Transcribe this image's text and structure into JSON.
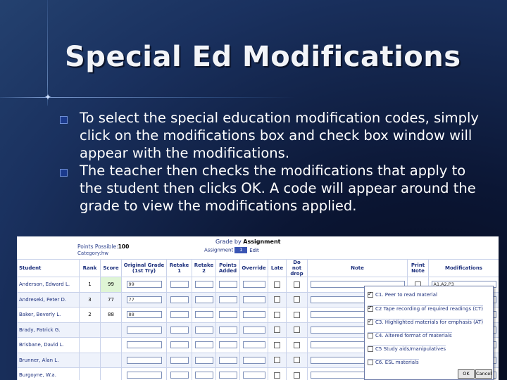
{
  "slide": {
    "title": "Special Ed Modifications",
    "bullets": [
      "To select the special education modification codes, simply click on the modifications box and check box window will appear with the modifications.",
      "The teacher then checks the modifications that apply to the student then clicks OK. A code will appear around the grade to view the modifications applied."
    ]
  },
  "screenshot": {
    "points_possible_label": "Points Possible:",
    "points_possible_value": "100",
    "category_label": "Category:hw",
    "grade_by_label": "Grade by",
    "grade_by_value": "Assignment",
    "assignment_label": "Assignment",
    "assignment_value": "1",
    "edit_label": "Edit",
    "columns": [
      "Student",
      "Rank",
      "Score",
      "Original Grade (1st Try)",
      "Retake 1",
      "Retake 2",
      "Points Added",
      "Override",
      "Late",
      "Do not drop",
      "Note",
      "Print Note",
      "Modifications"
    ],
    "rows": [
      {
        "student": "Anderson, Edward L.",
        "rank": "1",
        "score": "99",
        "original": "99",
        "modifications": "A1,A2,P3"
      },
      {
        "student": "Andreseki, Peter D.",
        "rank": "3",
        "score": "77",
        "original": "77",
        "modifications": ""
      },
      {
        "student": "Baker, Beverly L.",
        "rank": "2",
        "score": "88",
        "original": "88",
        "modifications": ""
      },
      {
        "student": "Brady, Patrick G.",
        "rank": "",
        "score": "",
        "original": "",
        "modifications": ""
      },
      {
        "student": "Brisbane, David L.",
        "rank": "",
        "score": "",
        "original": "",
        "modifications": ""
      },
      {
        "student": "Brunner, Alan L.",
        "rank": "",
        "score": "",
        "original": "",
        "modifications": ""
      },
      {
        "student": "Burgoyne, W.a.",
        "rank": "",
        "score": "",
        "original": "",
        "modifications": ""
      }
    ],
    "popup": {
      "options": [
        {
          "label": "C1. Peer to read material",
          "checked": true
        },
        {
          "label": "C2 Tape recording of required readings (CT)",
          "checked": true
        },
        {
          "label": "C3. Highlighted materials for emphasis (AT)",
          "checked": true
        },
        {
          "label": "C4. Altered format of materials",
          "checked": false
        },
        {
          "label": "C5 Study aids/manipulatives",
          "checked": false
        },
        {
          "label": "C6. ESL materials",
          "checked": false
        }
      ],
      "ok_label": "OK",
      "cancel_label": "Cancel"
    }
  }
}
